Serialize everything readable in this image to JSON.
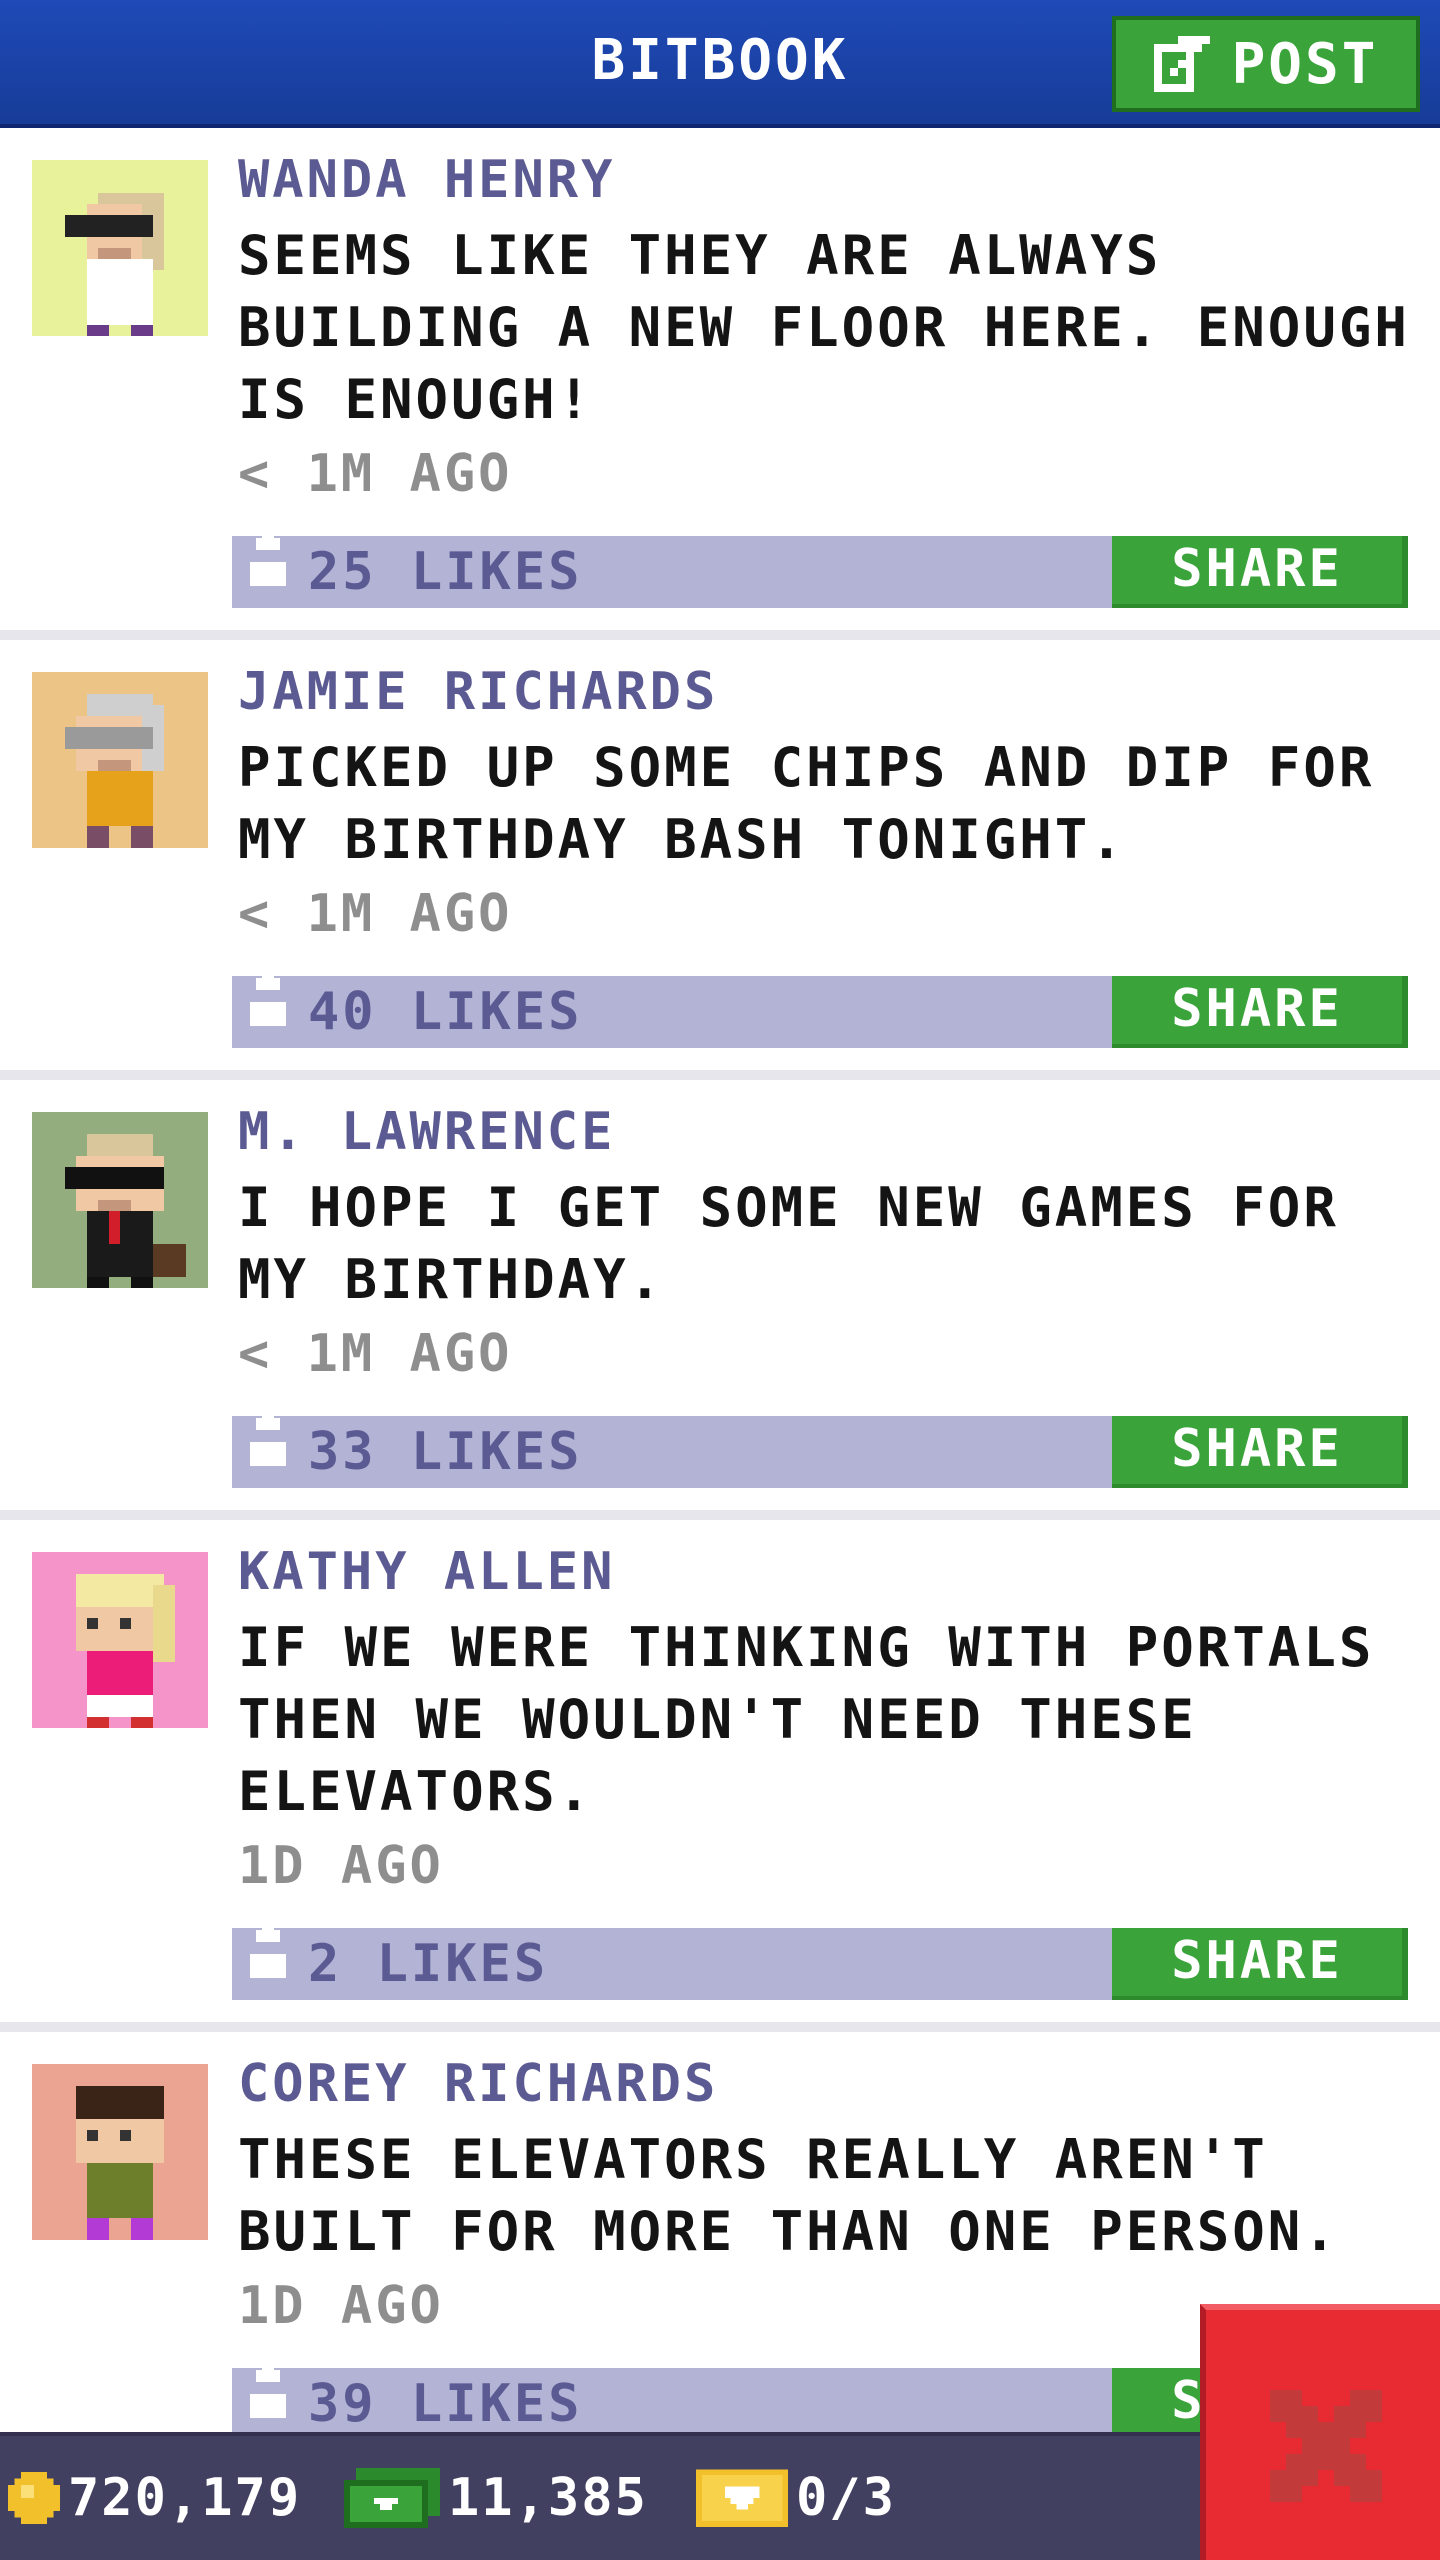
{
  "header": {
    "title": "BITBOOK",
    "post_label": "POST"
  },
  "posts": [
    {
      "author": "WANDA HENRY",
      "message": "SEEMS LIKE THEY ARE ALWAYS BUILDING A NEW FLOOR HERE. ENOUGH IS ENOUGH!",
      "time": "< 1M AGO",
      "likes": "25 LIKES",
      "share_label": "SHARE",
      "avatar_bg": "#e8f29a"
    },
    {
      "author": "JAMIE RICHARDS",
      "message": "PICKED UP SOME CHIPS AND DIP FOR MY BIRTHDAY BASH TONIGHT.",
      "time": "< 1M AGO",
      "likes": "40 LIKES",
      "share_label": "SHARE",
      "avatar_bg": "#ecc586"
    },
    {
      "author": "M. LAWRENCE",
      "message": "I HOPE I GET SOME NEW GAMES FOR MY BIRTHDAY.",
      "time": "< 1M AGO",
      "likes": "33 LIKES",
      "share_label": "SHARE",
      "avatar_bg": "#93ad7e"
    },
    {
      "author": "KATHY ALLEN",
      "message": "IF WE WERE THINKING WITH PORTALS THEN WE WOULDN'T NEED THESE ELEVATORS.",
      "time": "1D AGO",
      "likes": "2 LIKES",
      "share_label": "SHARE",
      "avatar_bg": "#f594c9"
    },
    {
      "author": "COREY RICHARDS",
      "message": "THESE ELEVATORS REALLY AREN'T BUILT FOR MORE THAN ONE PERSON.",
      "time": "1D AGO",
      "likes": "39 LIKES",
      "share_label": "SHARE",
      "avatar_bg": "#eba491"
    }
  ],
  "footer": {
    "coins": "720,179",
    "bux": "11,385",
    "tickets": "0/3"
  },
  "colors": {
    "header_blue": "#1f4ab7",
    "action_green": "#3aa33a",
    "likes_bar": "#b3b3d6",
    "close_red": "#e82b33",
    "footer": "#424060"
  }
}
